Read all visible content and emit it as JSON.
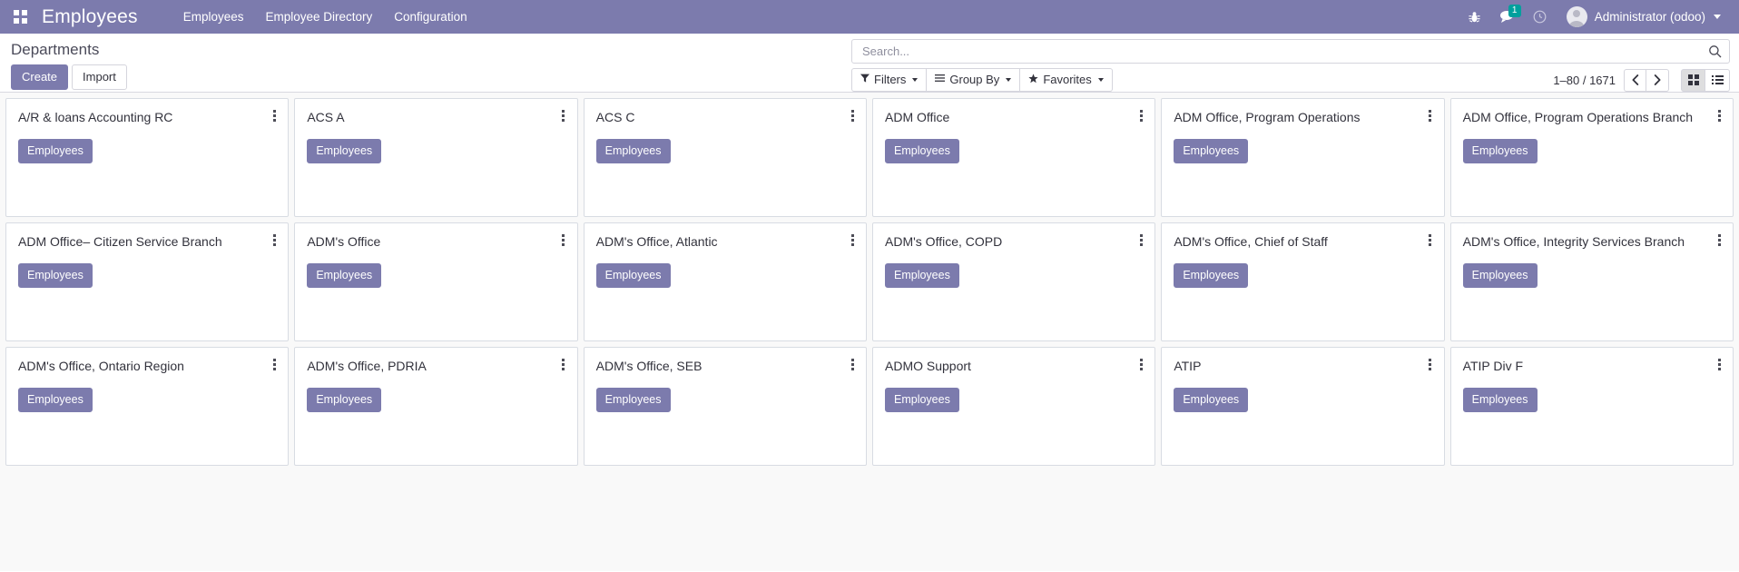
{
  "navbar": {
    "apps_icon": "apps-grid-icon",
    "brand": "Employees",
    "menu": [
      {
        "label": "Employees"
      },
      {
        "label": "Employee Directory"
      },
      {
        "label": "Configuration"
      }
    ],
    "right": {
      "debug_icon": "bug-icon",
      "messages_icon": "chat-bubble-icon",
      "messages_count": "1",
      "activities_icon": "clock-icon",
      "avatar_icon": "user-avatar-icon",
      "user_name": "Administrator (odoo)",
      "caret_icon": "caret-down-icon"
    },
    "colors": {
      "background": "#7C7BAD",
      "badge": "#00A09D",
      "text": "#FFFFFF"
    }
  },
  "control_panel": {
    "breadcrumb": "Departments",
    "create_label": "Create",
    "import_label": "Import",
    "search": {
      "placeholder": "Search...",
      "value": "",
      "icon": "search-icon"
    },
    "filters": [
      {
        "label": "Filters",
        "icon": "funnel-icon"
      },
      {
        "label": "Group By",
        "icon": "hamburger-icon"
      },
      {
        "label": "Favorites",
        "icon": "star-icon"
      }
    ],
    "pager": {
      "count": "1–80 / 1671",
      "prev_icon": "chevron-left-icon",
      "next_icon": "chevron-right-icon"
    },
    "view_switcher": [
      {
        "name": "kanban",
        "icon": "kanban-view-icon",
        "active": true
      },
      {
        "name": "list",
        "icon": "list-view-icon",
        "active": false
      }
    ]
  },
  "kanban": {
    "button_label": "Employees",
    "menu_icon": "vertical-dots-icon",
    "cards": [
      {
        "title": "A/R & loans Accounting RC"
      },
      {
        "title": "ACS A"
      },
      {
        "title": "ACS C"
      },
      {
        "title": "ADM Office"
      },
      {
        "title": "ADM Office, Program Operations"
      },
      {
        "title": "ADM Office, Program Operations Branch"
      },
      {
        "title": "ADM Office– Citizen Service Branch"
      },
      {
        "title": "ADM's Office"
      },
      {
        "title": "ADM's Office, Atlantic"
      },
      {
        "title": "ADM's Office, COPD"
      },
      {
        "title": "ADM's Office, Chief of Staff"
      },
      {
        "title": "ADM's Office, Integrity Services Branch"
      },
      {
        "title": "ADM's Office, Ontario Region"
      },
      {
        "title": "ADM's Office, PDRIA"
      },
      {
        "title": "ADM's Office, SEB"
      },
      {
        "title": "ADMO Support"
      },
      {
        "title": "ATIP"
      },
      {
        "title": "ATIP Div F"
      }
    ]
  }
}
